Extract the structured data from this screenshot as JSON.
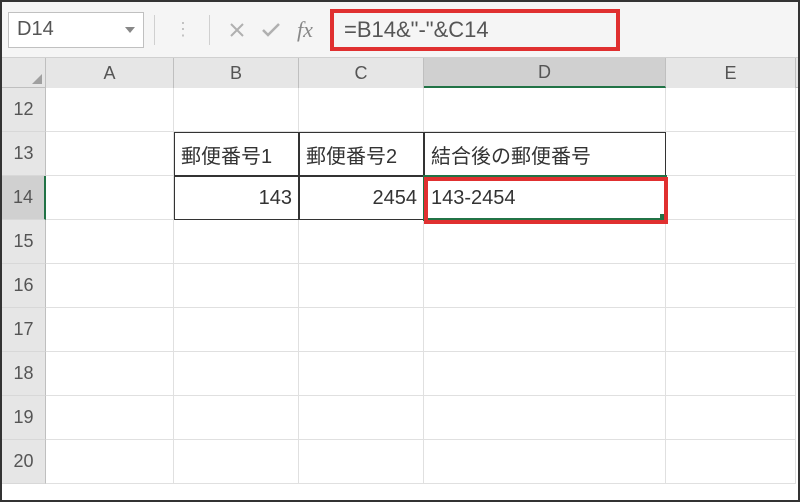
{
  "nameBox": "D14",
  "formula": "=B14&\"-\"&C14",
  "columns": [
    "A",
    "B",
    "C",
    "D",
    "E"
  ],
  "rows": [
    "12",
    "13",
    "14",
    "15",
    "16",
    "17",
    "18",
    "19",
    "20"
  ],
  "activeRow": "14",
  "activeCol": "D",
  "cells": {
    "B13": "郵便番号1",
    "C13": "郵便番号2",
    "D13": "結合後の郵便番号",
    "B14": "143",
    "C14": "2454",
    "D14": "143-2454"
  },
  "fxLabel": "fx"
}
